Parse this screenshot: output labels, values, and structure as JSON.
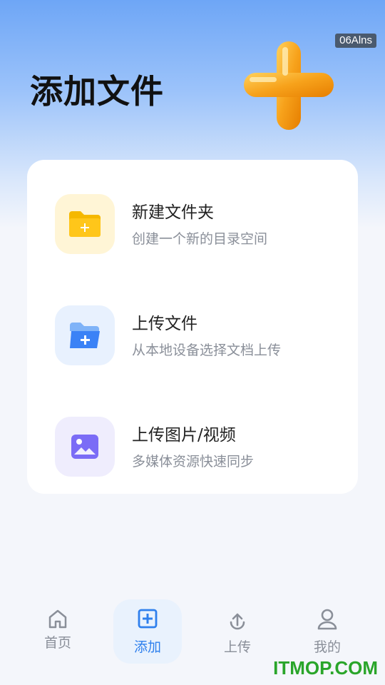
{
  "status": {
    "badge": "06Alns"
  },
  "header": {
    "title": "添加文件"
  },
  "options": [
    {
      "title": "新建文件夹",
      "desc": "创建一个新的目录空间",
      "icon": "folder-add-icon",
      "color": "#f5b800"
    },
    {
      "title": "上传文件",
      "desc": "从本地设备选择文档上传",
      "icon": "folder-upload-icon",
      "color": "#3b82f6"
    },
    {
      "title": "上传图片/视频",
      "desc": "多媒体资源快速同步",
      "icon": "image-icon",
      "color": "#7b6cf6"
    }
  ],
  "tabbar": {
    "items": [
      {
        "label": "首页",
        "icon": "home-icon",
        "active": false
      },
      {
        "label": "添加",
        "icon": "add-square-icon",
        "active": true
      },
      {
        "label": "上传",
        "icon": "upload-icon",
        "active": false
      },
      {
        "label": "我的",
        "icon": "user-icon",
        "active": false
      }
    ]
  },
  "watermark": {
    "text": "ITMOP.COM"
  },
  "colors": {
    "accent": "#2f80ed",
    "muted": "#8a8f99"
  }
}
